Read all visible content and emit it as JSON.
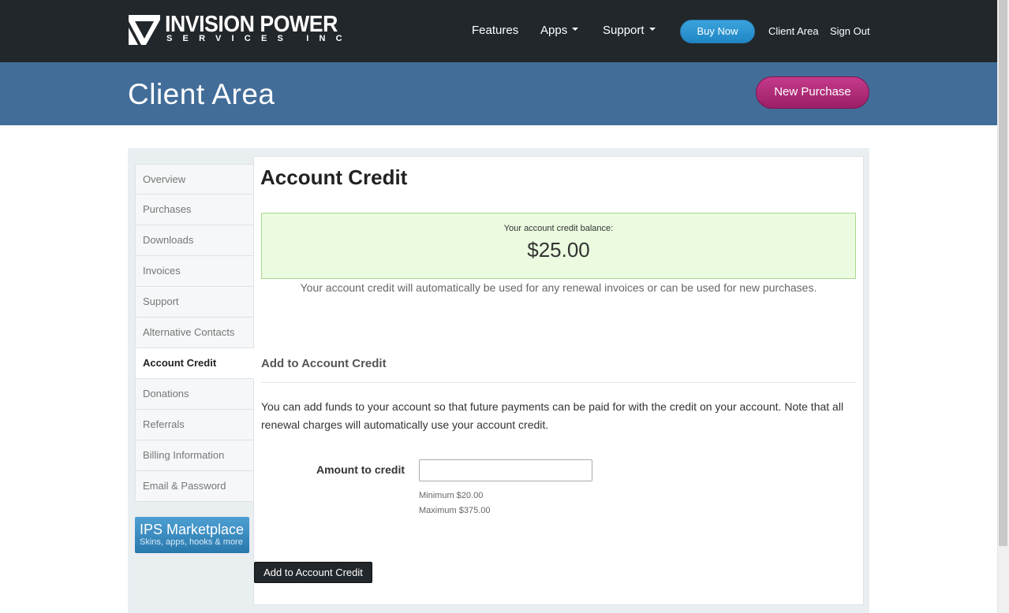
{
  "brand": {
    "line1": "INVISION POWER",
    "line2": "SERVICES INC"
  },
  "nav": {
    "features": "Features",
    "apps": "Apps",
    "support": "Support",
    "buy_now": "Buy Now",
    "client_area": "Client Area",
    "sign_out": "Sign Out"
  },
  "header": {
    "title": "Client Area",
    "new_purchase": "New Purchase"
  },
  "sidebar": {
    "items": [
      {
        "label": "Overview",
        "active": false
      },
      {
        "label": "Purchases",
        "active": false
      },
      {
        "label": "Downloads",
        "active": false
      },
      {
        "label": "Invoices",
        "active": false
      },
      {
        "label": "Support",
        "active": false
      },
      {
        "label": "Alternative Contacts",
        "active": false
      },
      {
        "label": "Account Credit",
        "active": true
      },
      {
        "label": "Donations",
        "active": false
      },
      {
        "label": "Referrals",
        "active": false
      },
      {
        "label": "Billing Information",
        "active": false
      },
      {
        "label": "Email & Password",
        "active": false
      }
    ],
    "marketplace": {
      "title": "IPS Marketplace",
      "subtitle": "Skins, apps, hooks & more"
    }
  },
  "main": {
    "title": "Account Credit",
    "balance_label": "Your account credit balance:",
    "balance_amount": "$25.00",
    "balance_note": "Your account credit will automatically be used for any renewal invoices or can be used for new purchases.",
    "section_title": "Add to Account Credit",
    "description": "You can add funds to your account so that future payments can be paid for with the credit on your account. Note that all renewal charges will automatically use your account credit.",
    "amount_label": "Amount to credit",
    "amount_value": "",
    "minimum": "Minimum $20.00",
    "maximum": "Maximum $375.00",
    "submit": "Add to Account Credit"
  },
  "colors": {
    "topbar": "#22272b",
    "band": "#426d99",
    "buy_now": "#2a93d1",
    "new_purchase": "#b02d79",
    "balance_bg": "#eafbdf"
  }
}
